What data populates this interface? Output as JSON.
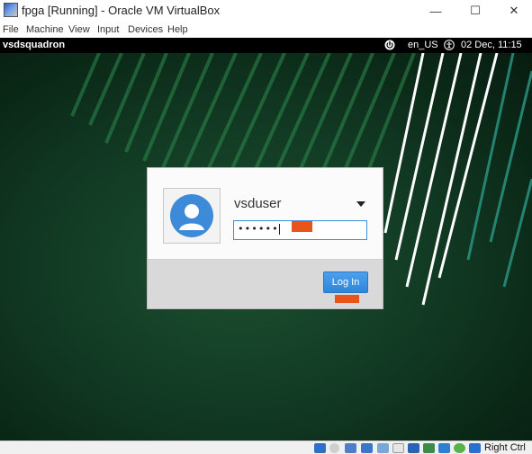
{
  "window": {
    "title": "fpga [Running] - Oracle VM VirtualBox",
    "controls": {
      "minimize": "—",
      "maximize": "☐",
      "close": "✕"
    }
  },
  "menu": [
    {
      "label": "File"
    },
    {
      "label": "Machine"
    },
    {
      "label": "View"
    },
    {
      "label": "Input"
    },
    {
      "label": "Devices"
    },
    {
      "label": "Help"
    }
  ],
  "guest_panel": {
    "hostname": "vsdsquadron",
    "power_icon": "power-icon",
    "accessibility_icon": "accessibility-icon",
    "keyboard_layout": "en_US",
    "datetime": "02 Dec, 11:15"
  },
  "login": {
    "avatar_icon": "user-avatar-icon",
    "username": "vsduser",
    "user_dropdown_icon": "chevron-down-icon",
    "password_masked": "••••••",
    "login_button": "Log In",
    "accent_color": "#3b8fe0"
  },
  "statusbar": {
    "icons": [
      "hard-disk-icon",
      "optical-drive-icon",
      "audio-icon",
      "network-icon",
      "usb-icon",
      "shared-folders-icon",
      "display-icon",
      "video-capture-icon",
      "cpu-icon",
      "mouse-integration-icon",
      "keyboard-capture-icon"
    ],
    "host_key": "Right Ctrl"
  }
}
